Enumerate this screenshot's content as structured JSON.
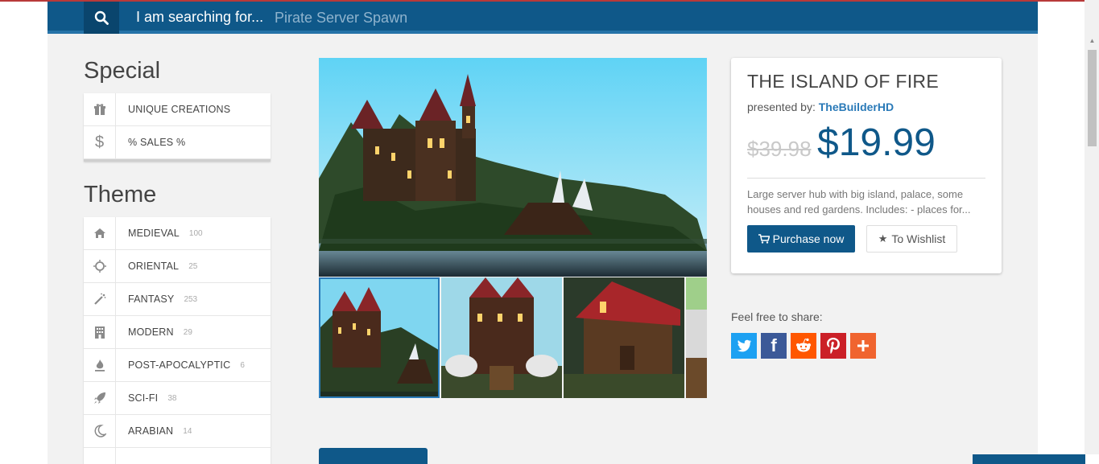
{
  "search": {
    "label": "I am searching for...",
    "placeholder": "Pirate Server Spawn"
  },
  "sidebar": {
    "special_title": "Special",
    "special_items": [
      {
        "icon": "gift-icon",
        "label": "UNIQUE CREATIONS"
      },
      {
        "icon": "dollar-icon",
        "label": "% SALES %"
      }
    ],
    "theme_title": "Theme",
    "theme_items": [
      {
        "icon": "home-icon",
        "label": "MEDIEVAL",
        "count": "100"
      },
      {
        "icon": "sun-icon",
        "label": "ORIENTAL",
        "count": "25"
      },
      {
        "icon": "magic-wand-icon",
        "label": "FANTASY",
        "count": "253"
      },
      {
        "icon": "building-icon",
        "label": "MODERN",
        "count": "29"
      },
      {
        "icon": "fire-icon",
        "label": "POST-APOCALYPTIC",
        "count": "6"
      },
      {
        "icon": "rocket-icon",
        "label": "SCI-FI",
        "count": "38"
      },
      {
        "icon": "moon-icon",
        "label": "ARABIAN",
        "count": "14"
      }
    ]
  },
  "product": {
    "title": "THE ISLAND OF FIRE",
    "presented_by": "presented by:",
    "author": "TheBuilderHD",
    "old_price": "$39.98",
    "price": "$19.99",
    "description": "Large server hub with big island, palace, some houses and red gardens. Includes: - places for...",
    "purchase_label": "Purchase now",
    "wishlist_label": "To Wishlist"
  },
  "share": {
    "label": "Feel free to share:",
    "buttons": [
      {
        "name": "twitter",
        "color": "#1da1f2"
      },
      {
        "name": "facebook",
        "color": "#3b5998"
      },
      {
        "name": "reddit",
        "color": "#ff5700"
      },
      {
        "name": "pinterest",
        "color": "#cb2027"
      },
      {
        "name": "more",
        "color": "#f0642f"
      }
    ]
  },
  "colors": {
    "brand": "#0f5889",
    "accent_link": "#2a7ab8"
  }
}
